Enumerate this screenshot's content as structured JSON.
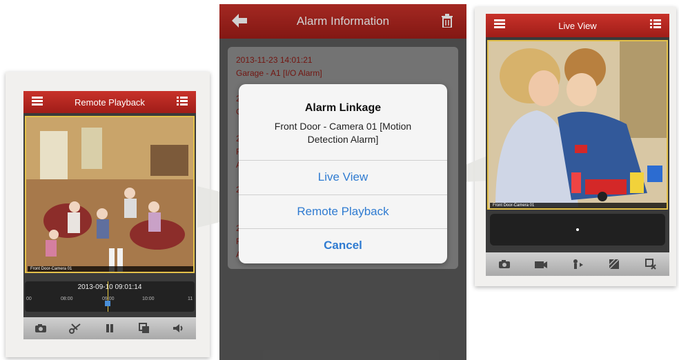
{
  "left_phone": {
    "title": "Remote Playback",
    "camera_label": "Front Door-Camera 01",
    "timeline_date": "2013-09-10 09:01:14",
    "ticks": [
      "00",
      "08:00",
      "09:00",
      "10:00",
      "11"
    ],
    "toolbar": [
      "camera-icon",
      "scissors-icon",
      "pause-icon",
      "layers-icon",
      "speaker-icon"
    ]
  },
  "middle_phone": {
    "title": "Alarm Information",
    "alarms": [
      {
        "timestamp": "2013-11-23 14:01:21",
        "name": "Garage - A1 [I/O Alarm]"
      },
      {
        "timestamp": "2",
        "name": "G"
      },
      {
        "timestamp": "2",
        "name": "F"
      },
      {
        "timestamp": "",
        "name": "A"
      },
      {
        "timestamp": "2",
        "name": ""
      },
      {
        "timestamp": "2",
        "name": "F"
      },
      {
        "timestamp": "",
        "name": "A"
      }
    ],
    "dialog": {
      "title": "Alarm Linkage",
      "message": "Front Door - Camera 01 [Motion Detection Alarm]",
      "buttons": [
        "Live View",
        "Remote Playback",
        "Cancel"
      ]
    }
  },
  "right_phone": {
    "title": "Live View",
    "camera_label": "Front Door-Camera 01",
    "toolbar": [
      "camera-icon",
      "video-record-icon",
      "ptz-icon",
      "quality-icon",
      "close-window-icon"
    ]
  },
  "colors": {
    "header_red": "#b4241e",
    "link_blue": "#2f7bd1",
    "alarm_text_red": "#8b1a14"
  }
}
